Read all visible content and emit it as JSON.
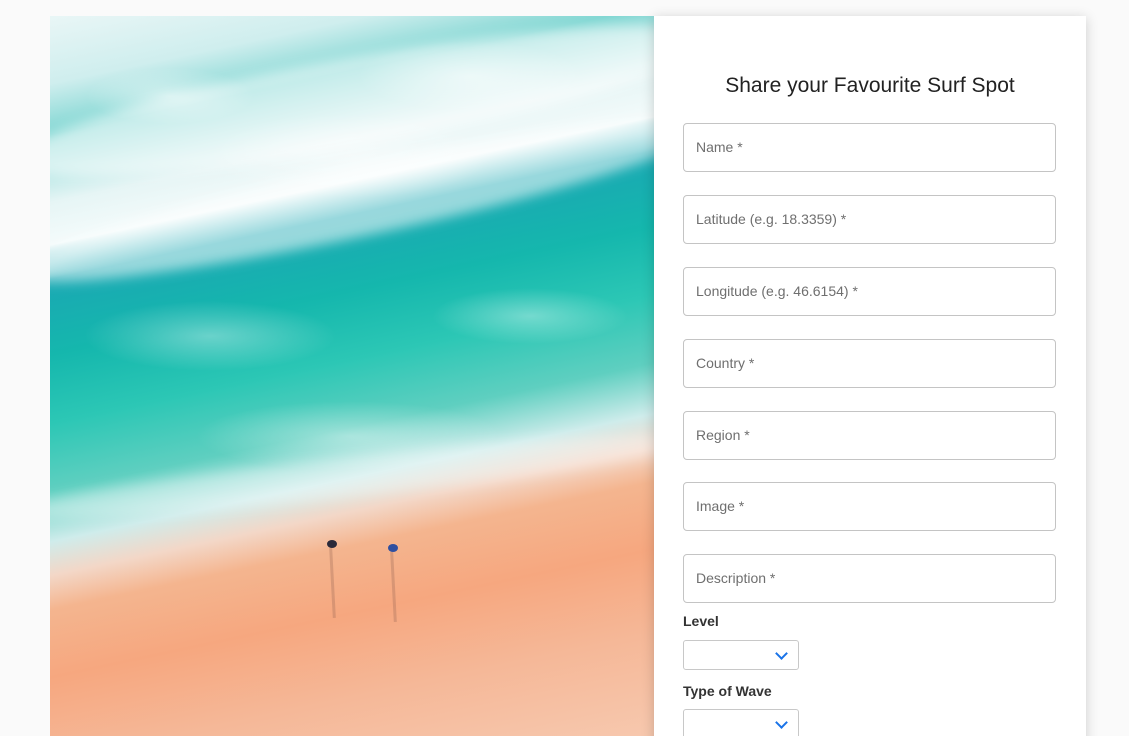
{
  "form": {
    "title": "Share your Favourite Surf Spot",
    "fields": [
      {
        "label": "Name *"
      },
      {
        "label": "Latitude (e.g. 18.3359) *"
      },
      {
        "label": "Longitude (e.g. 46.6154) *"
      },
      {
        "label": "Country *"
      },
      {
        "label": "Region *"
      },
      {
        "label": "Image *"
      },
      {
        "label": "Description *"
      }
    ],
    "level": {
      "label": "Level",
      "value": ""
    },
    "wave_type": {
      "label": "Type of Wave",
      "value": ""
    }
  },
  "colors": {
    "accent": "#1a73e8",
    "field_border": "#c4c4c4",
    "placeholder_text": "#6f6f6f"
  },
  "icons": {
    "dropdown": "chevron-down-icon"
  }
}
